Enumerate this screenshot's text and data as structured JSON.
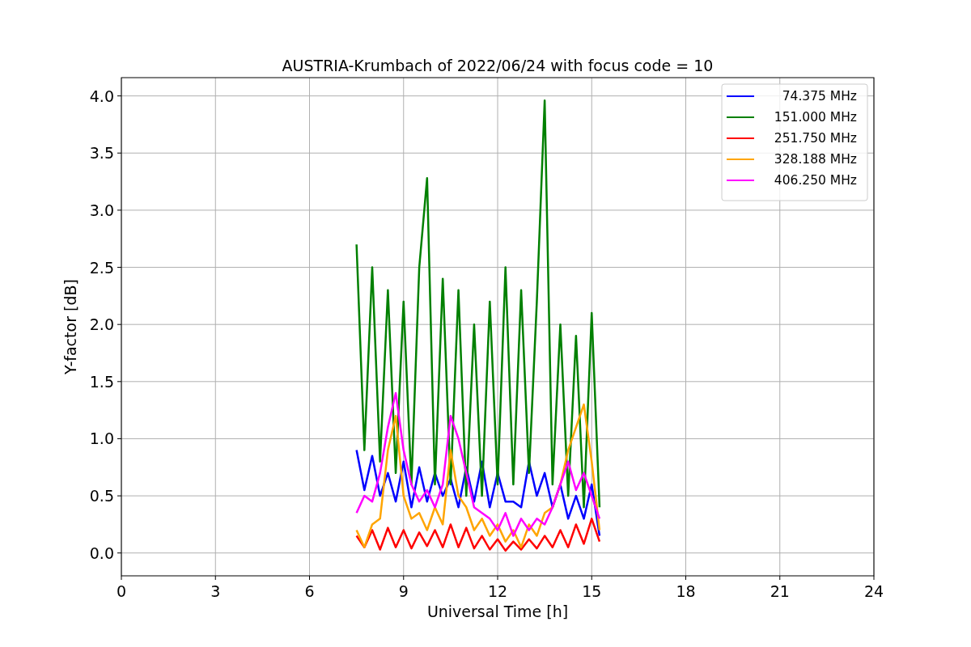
{
  "chart_data": {
    "type": "line",
    "title": "AUSTRIA-Krumbach of 2022/06/24 with focus code = 10",
    "xlabel": "Universal Time [h]",
    "ylabel": "Y-factor [dB]",
    "x": [
      7.5,
      7.75,
      8,
      8.25,
      8.5,
      8.75,
      9,
      9.25,
      9.5,
      9.75,
      10,
      10.25,
      10.5,
      10.75,
      11,
      11.25,
      11.5,
      11.75,
      12,
      12.25,
      12.5,
      12.75,
      13,
      13.25,
      13.5,
      13.75,
      14,
      14.25,
      14.5,
      14.75,
      15,
      15.25
    ],
    "grid": true,
    "legend": true,
    "xlim": [
      0,
      24
    ],
    "ylim": [
      -0.2,
      4.16
    ],
    "xticks": [
      0,
      3,
      6,
      9,
      12,
      15,
      18,
      21,
      24
    ],
    "yticks": [
      {
        "value": 0,
        "label": "0.0"
      },
      {
        "value": 0.5,
        "label": "0.5"
      },
      {
        "value": 1,
        "label": "1.0"
      },
      {
        "value": 1.5,
        "label": "1.5"
      },
      {
        "value": 2,
        "label": "2.0"
      },
      {
        "value": 2.5,
        "label": "2.5"
      },
      {
        "value": 3,
        "label": "3.0"
      },
      {
        "value": 3.5,
        "label": "3.5"
      },
      {
        "value": 4,
        "label": "4.0"
      }
    ],
    "series": [
      {
        "name": "74.375 MHz",
        "color": "#0000ff",
        "values": [
          0.9,
          0.55,
          0.85,
          0.5,
          0.7,
          0.45,
          0.8,
          0.4,
          0.75,
          0.45,
          0.7,
          0.5,
          0.65,
          0.4,
          0.75,
          0.45,
          0.8,
          0.4,
          0.7,
          0.45,
          0.45,
          0.4,
          0.8,
          0.5,
          0.7,
          0.4,
          0.6,
          0.3,
          0.5,
          0.3,
          0.6,
          0.15
        ]
      },
      {
        "name": "151.000 MHz",
        "color": "#008000",
        "values": [
          2.7,
          0.9,
          2.5,
          0.8,
          2.3,
          0.7,
          2.2,
          0.6,
          2.5,
          3.28,
          0.6,
          2.4,
          0.6,
          2.3,
          0.5,
          2.0,
          0.5,
          2.2,
          0.6,
          2.5,
          0.6,
          2.3,
          0.7,
          2.2,
          3.96,
          0.6,
          2.0,
          0.5,
          1.9,
          0.4,
          2.1,
          0.4
        ]
      },
      {
        "name": "251.750 MHz",
        "color": "#ff0000",
        "values": [
          0.15,
          0.05,
          0.2,
          0.03,
          0.22,
          0.05,
          0.2,
          0.04,
          0.18,
          0.06,
          0.2,
          0.05,
          0.25,
          0.05,
          0.22,
          0.04,
          0.15,
          0.03,
          0.12,
          0.02,
          0.1,
          0.03,
          0.12,
          0.04,
          0.15,
          0.05,
          0.2,
          0.05,
          0.25,
          0.08,
          0.3,
          0.1
        ]
      },
      {
        "name": "328.188 MHz",
        "color": "#ffa500",
        "values": [
          0.2,
          0.05,
          0.25,
          0.3,
          0.9,
          1.2,
          0.5,
          0.3,
          0.35,
          0.2,
          0.4,
          0.25,
          0.9,
          0.5,
          0.4,
          0.2,
          0.3,
          0.15,
          0.25,
          0.1,
          0.2,
          0.05,
          0.25,
          0.15,
          0.35,
          0.4,
          0.6,
          0.9,
          1.1,
          1.3,
          0.8,
          0.2
        ]
      },
      {
        "name": "406.250 MHz",
        "color": "#ff00ff",
        "values": [
          0.35,
          0.5,
          0.45,
          0.7,
          1.1,
          1.4,
          0.9,
          0.6,
          0.45,
          0.55,
          0.4,
          0.6,
          1.2,
          1.0,
          0.7,
          0.4,
          0.35,
          0.3,
          0.2,
          0.35,
          0.15,
          0.3,
          0.2,
          0.3,
          0.25,
          0.4,
          0.6,
          0.8,
          0.55,
          0.7,
          0.5,
          0.3
        ]
      }
    ]
  }
}
